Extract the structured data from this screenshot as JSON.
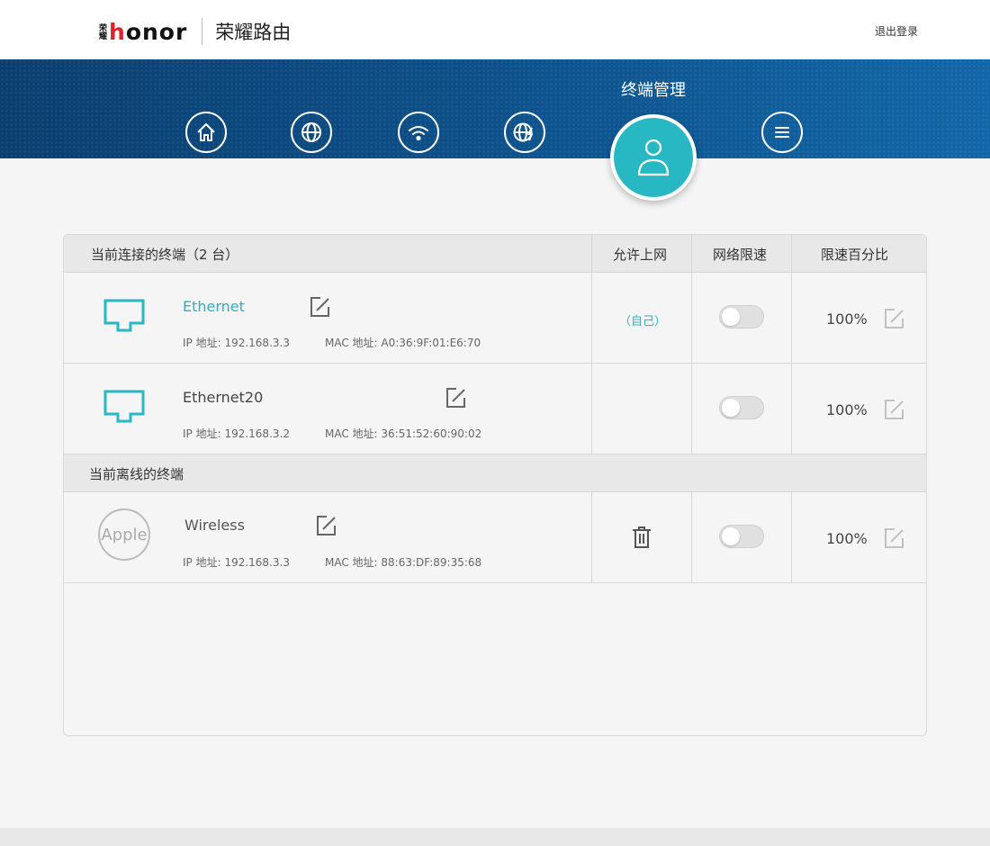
{
  "header": {
    "brand_cn_small": "荣耀",
    "brand_text": "honor",
    "product_name": "荣耀路由",
    "logout_label": "退出登录"
  },
  "nav": {
    "active_title": "终端管理",
    "items": [
      {
        "icon": "home-icon"
      },
      {
        "icon": "globe-icon"
      },
      {
        "icon": "wifi-icon"
      },
      {
        "icon": "globe-speed-icon"
      },
      {
        "icon": "user-icon",
        "active": true
      },
      {
        "icon": "menu-icon"
      }
    ]
  },
  "table": {
    "headers": {
      "connected": "当前连接的终端（2 台）",
      "allow_internet": "允许上网",
      "speed_limit": "网络限速",
      "speed_percent": "限速百分比"
    },
    "offline_section": "当前离线的终端",
    "online_devices": [
      {
        "name": "Ethernet",
        "ip": "IP 地址: 192.168.3.3",
        "mac": "MAC 地址: A0:36:9F:01:E6:70",
        "allow": "（自己）",
        "speed_limit_on": false,
        "percent": "100%",
        "icon": "monitor-icon"
      },
      {
        "name": "Ethernet20",
        "ip": "IP 地址: 192.168.3.2",
        "mac": "MAC 地址: 36:51:52:60:90:02",
        "allow": "",
        "speed_limit_on": false,
        "percent": "100%",
        "icon": "monitor-icon"
      }
    ],
    "offline_devices": [
      {
        "name": "Wireless",
        "ip": "IP 地址: 192.168.3.3",
        "mac": "MAC 地址: 88:63:DF:89:35:68",
        "logo_text": "Apple",
        "speed_limit_on": false,
        "percent": "100%",
        "icon": "apple-logo"
      }
    ]
  },
  "colors": {
    "accent": "#27b8c3",
    "banner": "#0d4f87",
    "brand_red": "#e0242e"
  }
}
